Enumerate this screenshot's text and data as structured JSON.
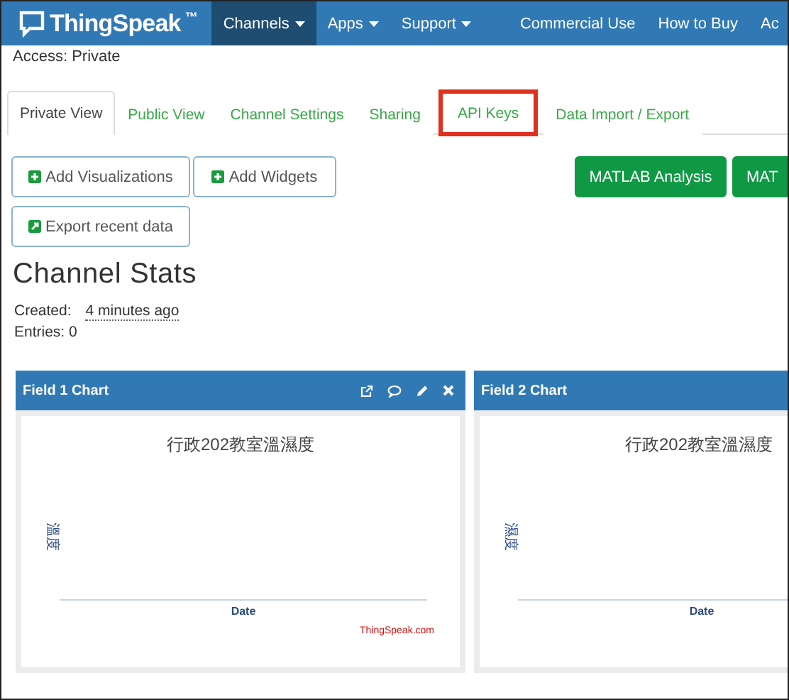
{
  "nav": {
    "logo": "ThingSpeak",
    "trademark": "™",
    "items": [
      {
        "label": "Channels",
        "dropdown": true,
        "selected": true
      },
      {
        "label": "Apps",
        "dropdown": true,
        "selected": false
      },
      {
        "label": "Support",
        "dropdown": true,
        "selected": false
      },
      {
        "label": "Commercial Use",
        "dropdown": false,
        "selected": false
      },
      {
        "label": "How to Buy",
        "dropdown": false,
        "selected": false
      },
      {
        "label": "Ac",
        "dropdown": false,
        "selected": false
      }
    ]
  },
  "access": "Access: Private",
  "tabs": [
    {
      "label": "Private View",
      "selected": true,
      "highlighted": false
    },
    {
      "label": "Public View",
      "selected": false,
      "highlighted": false
    },
    {
      "label": "Channel Settings",
      "selected": false,
      "highlighted": false
    },
    {
      "label": "Sharing",
      "selected": false,
      "highlighted": false
    },
    {
      "label": "API Keys",
      "selected": false,
      "highlighted": true
    },
    {
      "label": "Data Import / Export",
      "selected": false,
      "highlighted": false
    }
  ],
  "buttons": [
    {
      "label": "Add Visualizations",
      "kind": "add"
    },
    {
      "label": "Add Widgets",
      "kind": "add"
    },
    {
      "label": "MATLAB Analysis",
      "kind": "analysis"
    },
    {
      "label": "MAT",
      "kind": "analysis"
    },
    {
      "label": "Export recent data",
      "kind": "export"
    }
  ],
  "stats": {
    "heading": "Channel Stats",
    "created_label": "Created:",
    "created_value": "4 minutes ago",
    "entries": "Entries: 0"
  },
  "charts": [
    {
      "title": "Field 1 Chart",
      "controls": true,
      "credit": "ThingSpeak.com",
      "plot": {
        "kind": "empty",
        "title": "行政202教室溫濕度",
        "xlabel": "Date",
        "ylabel": "溫度"
      }
    },
    {
      "title": "Field 2 Chart",
      "controls": false,
      "plot": {
        "kind": "empty",
        "title": "行政202教室溫濕度",
        "xlabel": "Date",
        "ylabel": "濕度"
      }
    }
  ]
}
